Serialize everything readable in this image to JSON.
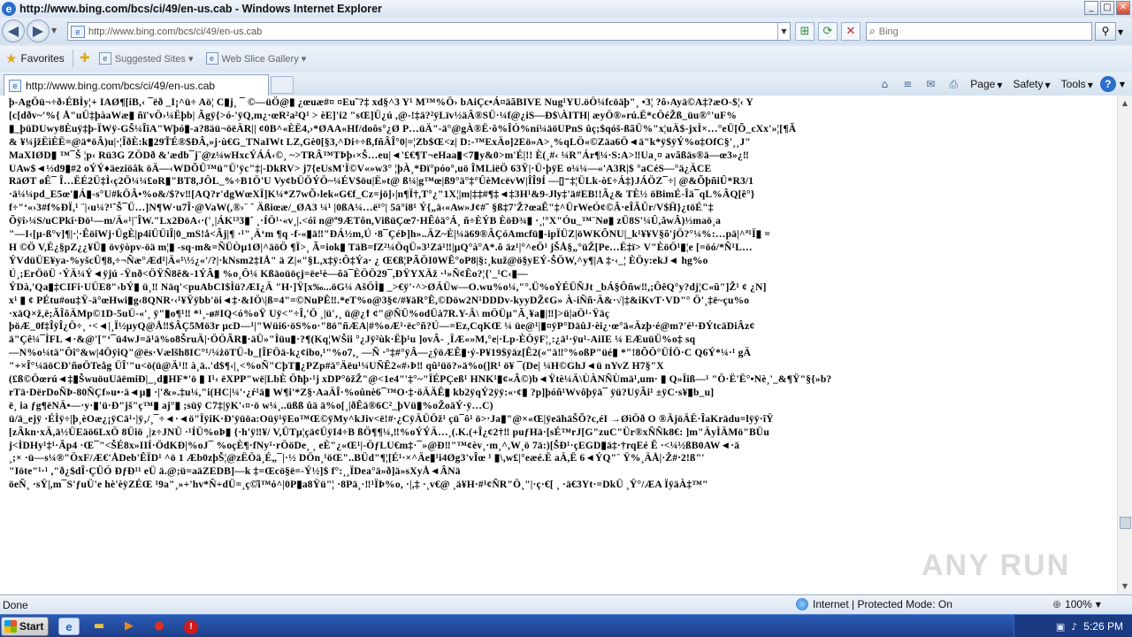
{
  "window": {
    "title": "http://www.bing.com/bcs/ci/49/en-us.cab - Windows Internet Explorer",
    "app_icon_glyph": "e",
    "controls": {
      "minimize": "_",
      "maximize": "□",
      "close": "✕"
    }
  },
  "address_bar": {
    "url": "http://www.bing.com/bcs/ci/49/en-us.cab",
    "search_placeholder": "Bing",
    "icons": [
      "back-arrow-icon",
      "forward-arrow-icon",
      "compatibility-view-icon",
      "refresh-icon",
      "stop-icon",
      "search-icon"
    ]
  },
  "favorites_bar": {
    "favorites_label": "Favorites",
    "links": [
      {
        "label": "Suggested Sites ▾"
      },
      {
        "label": "Web Slice Gallery ▾"
      }
    ]
  },
  "tab": {
    "label": "http://www.bing.com/bcs/ci/49/en-us.cab"
  },
  "command_bar": {
    "items": [
      "Page",
      "Safety",
      "Tools"
    ]
  },
  "content": {
    "lines": [
      "þ-AgÖü¬÷ð›ÉBÌy¦+ IAØ¶[iB,‹ ¯ëð _I¡^ü÷ Aö¦ C▮j¸ ¯ ©—üÖ@▮ ¿œuæ#¤ ¤Eu˜?‡ xd§^3 Y¹ M™%Ö› bAiÇc•Á¤äãBIVE Nug¹YU.öÖ¼fcöäþ\"¸ •3¦ ?ô›Ayä©A‡?æO-$¦‹ Y",
      "[c[dðv~'%{ Å\"uÜ‡þàaWæ▮ ñï'vÖ›¼Ëþb| Ãgÿ{>ó-'ÿQ,m¿·œR²a²Q¹ > èE]'i2 \"sŒ]Ü¿ú ,@-!‡ä?²ÿLïv½äÂ®SÜ·¼f@¿iS—Ð$\\ÀITH| æyÖ®»rú.Ë*cÖéŽß_üu®°'uF%",
      "▮_þüDUwy8Èuÿ‡þ-ÏWÿ-GŠ¼ÎîA\"Wþó▮-a?8äü¬öëÄR|| ¢0B^«ÈË4,›*ØAA«Hf/doôs°¿Ø P…üÄ\"-ä°@gÀ®Ë·ô%ÎÓ%ní¼äöUPnS ûç;$qóš-ßãÜ%\"x¦uÄ$-jxÌ×…°eÜ[Õ_cXx'»¦[¶Ã",
      "& ¥¼jžËìÈË=@ä*öÂ)u|·¦ÎðÈ:k▮29ŤÉ®$ÐÂ,»j·ù€G_TNaIWt LZ,Gè0[§3,^Di÷÷ß,fñÂÎ°0|=¦Zb$Œ<z| D:-™ExÄo]2Eö»A>¸%qLÖ«©Zäa6Ö◄ä\"k*ÿ$ÿÝ%o‡OfC§'¸¸J\"",
      "MaXIØD▮ ™¯Š ¦p‹ Rü3G ZÖDð &'ædb¯j¨@z¼wHxcÝÁÁ‹©¸ ~>TRÂ™TÞþ‹×Š…eu|◄'£€¶T¬eHaa▮<7▮y&0>m'É|!! È(¸#‹ ¼R\"Ár¶¼·S:A>‼Ua¸¤ avãßäs®ä—œ3»¿‼",
      "UAw$◄½d9▮#2 oÝÝ♦äeziöâk öÄ—‹WDÕÛ™ü\"Ü'ÿc\"‡|-DkRV> j7{eUsM'Ï©V«»w3° ¦þÀ¸*Ðï°póo°,uö ÎMLiëÖ 63Ÿ|·Ü·þÿE o¼¼—«'A3R|$ °aCéS—°ä¿ÄCE",
      "RäØT øÊ¯ Î…ËÉ2Ü‡Ì‹ç2Ö¼¼£oR▮\"BT8,JÔL_%÷B1Ö'U Vy¢bÜÖÝÖ~¼ÉV$öu|Ë»t@ ß¼|g™œ|ß9°ä°‡°ÛèMcëvW|ÎÎ9Í —▯⁻‡¦ÜLk-ò£÷Á‡}JÁÖZ¯÷| @&ÕþñiÛ*R3/1",
      "·ä¼¼pd_E5œ'▮Á▮-s°U#kÖÂ•%o&/$?v‼[AQ?r'dgWœXÏ]K¼*Z7wÕ›lek«G€f_Cz=jö]›|n¶Ï†,T°¿\"1X¦|m|‡‡#¶‡◄‡3H¹&9-Jly‡'ä#EB!!Ã¿& TÈ½ öBimÉ-Îä¯qL%ÂQ[ê°}",
      "f÷\"‘«›3#f%ÐÏ,¹ ¨|‹u¼?¹˜Š¯Ü…]N¶W·u7Î·@VaW(,®›¨ ˆ Äßiœæ/_ØA3 ¼¹ |0ßA¼…ë¹°| 5ä°i8¹ Ý{„ä‹«Aw»J¢#˜ §ß‡7'Ž?œaÊ\"‡^ÜrWeÓ¢©Â·eÎÂÛr/V$Ḧ}¿töÉ\"‡",
      "Õÿî›¼S/uCPkî·Ðö¹—m/Ä«¹|¨ÎW.\"Lx2ÐöA‹·('¸|ÁK¹³3▮ˆ ¸·ÍÖ¹·«v¸|.<óî n@º9ÆTôn,VißüÇœ7·HÊôä°Á¸ ñ÷ÈÝB ÈöÐ¾▮ ·¸¦°X\"Óu_™¨Nø▮ zÜ8S'¼Û,âwÂ)⅓maö¸a",
      "\"—I‹[µ-ß°v]¶|·¦·ÊöiWj·ÜgÈ|p4iÜÜiÎ|0_mS!å<Âj|¶ ·¹\"¸Ä‘m ¶q -f-«▮ä‼\"ÐÁ½m,Ú ·8¯ÇéÞ]h»..ÄZ~È|¼ä69®ÂÇóAmcfü▮-ipÏÜZ|öWKÕNU|_k¹¥¥V§õ'jÖ?°¼%:…pä|^ª¹Ï▮ =",
      "H ©Ö V,Ë¿§pZ¿¿¥Ü▮ övÿòpv-öä m¦▮ -sq-m&=ÑÜÒµ1Ø|^äöÖ ¶Ï>¸ Ã=iok▮ TäB=fZ²¼ÖqÜ»3¹Zä¹‼|µQ°à°A*.ô äz¹|°^eÖ¹ jŠÅ§„°üŽ[Pe…Ë‡ï> V\"ÈöÖ¹▮¦e [=öó/*Ñ¹L…",
      "ÝVdüÜE¥ya-%yšcÜ¶8,÷¬Ñæ°Æd¹|Ä«¹\\½¿«'/?|·kNsm2‡IÅ\" ä Z|«\"§L,x‡ÿ:Ô‡Ýa· ¿ Œ€ß¦PÃÖI0WÊ°oP8|§:¸kuž@ö§yEÝ-ŠÖW,^y¶|A ‡·‹_¦ ÈÖy:ekJ◄ hg%o",
      "Ú¸;ErÖöÜ ·ÝÄ¼Ý◄ÿjú -Ÿnð<ÖŸÑ8ê&-1ÝÂ▮ %o¸Ô¼ Kßäoüöçj=ëe¹è—ôä¯ÈÖÖ29¯,ÐŸYXÄž ·¹»Ñ¢Êo?¦{'_¹C‹▮—",
      "ÝDà,'Qa▮‡CIFi·UÜE8\"›bÝ▮ ü¸‼ Näq'<puAbCI$Ìü?ÆI¿Ä \"H·]Ÿ[x‰...öG¼ AšÖÌ▮ _>€ÿ'·^>ØÁÜw—O.wu%o¼,\"°.Ü%oÝÉÜÑJt _bÁ§Ôñw‼,;ÔêQ°y?dj¦C«û\"]Ž¹ ¢ ¿N]",
      "x¹ ▮ ¢ PÉtu#ou‡Ÿ-ä°œHwi▮g‹8QNR·‹¹¥Ÿÿbb'öi◄‡·&IÖ\\|ß=4\"=©NuPÊ‼.*eT%o@3§¢/#¥äR°Ê,©Döw2N¹DDDv-kyyDŽ¢G» À-iÑñ·Ä&·√|‡&iKvT·VD\"° Ö'¸‡ë~çu%o",
      "·xäQ×ž,ë;ÃÎôÄMp©1D-5uÜ-«'¸ ÿ\"▮o¶¹‼ *¹¸-ø#IQ<ó%oŸ Uÿ<\"÷Î,'Ö ¸|ü'‚¸ ü@¿ϯ ¢\"@ÑÜ%odÜà7R.Y-Â\\ mÖÜµ\"Ã¸¥a▮|‼]>ü|aÖ¹·Ÿäç",
      "þöÆ_0f‡ÎÿÎ¿Ö÷¸ ·<◄|¸Ï½µyQ@Å‼$ÂÇ5Mö3r µcD—¹|\"Wüi6·öS%o·\"8ö\"ñÆA|#%oÆ¹·ëc°ñ?Ú—=Ez,CqKŒ ¼ üe@¹|▮¤ÿP°DäûJ·èi¿·œ°ä«Äzþ·é@m?'é¹·ÐÝtcäDiÂz¢",
      "ä\"Çê¼¯ÌFL◄·&@'[\"‘¯ü4wJ=ä¹ä%o8ŠruÄ|·ÖÖÂR▮·äÜ»\"Ìüu▮·?¶(Kq¦WŠii °¿Jÿ²ùk·Ëþ¹u ]ovÂ- ¸ÏÆ«»M,°e|·Lp-ÈÖÿF¦¸:¿ä¹·ÿu¹-AiIE ¼ EÆuüÜ%o‡ sq",
      "—N%o¼tä\"Ôî°&w|4ÖÿiQ\"@ës·Vælšh8IC°¹/¼żöTÜ-b_[ÎFÖä-k¿¢ibo,¹\"%o7,¸ —Ñ ·°‡#°ÿÂ—¿ŷöÆÊ▮·ý-P¥19$ÿäz[Ê2(«\"ä‼°%oßP\"üé▮ *\"!8ÕÔ°ÜÍÖ·C Q6Ý*¼·¹ gÄ",
      "\"+×Î°¼äöCÐ'ñøÖTeåg ÜÎ'\"u<ö(ü@Ä¹‼ à¸ä..'d$¶‹|¸<%oÑ\"CþT▮¿PZp#ä°Äëu¹¼UÑÊ2«#›Þ‼ qû¹üö?»ä%o(]R¹ ö¥ ¯(De| ¼H©GhJ◄ü nYvZ H7§\"X",
      "(£ß©Öœrú◄‡▮ŠwuöuUäëmiÐ|_¸d▮HF*'ö ▮ I¹‹ ëXPP\"wë|LbÈ Öħþ·¹j xDP°öžŽ\"@<1e4\"'‡°~\"ÏÉPÇeß¹ HNK¹▮¢«Â©)b◄Ÿtè¼Ä\\ÙÀNÑÙmä¹,um· ▮ Q»Ïiß—¹ \"Ö·Ë'Ë°•Nè¸'_&¶Ÿ\"§{»b?",
      "rTä·DërDoÑÞ-80ÑÇf»u•·ä◄µ▮ ·|'&».‡u¼,\"i(HC|¼'·¿ŕ¹ä▮ W¶i'*Z§·AaÄÎ·%oûnè6¯™O·‡·öÄÄÊ▮ kb2ÿqÝ2ÿÿ:«·¢▮ ?p]þóñ¹Wvôþÿä¯ ÿü?UÿÃi¹ ±ÿC·s¥▮b_u]",
      "ë¸ ia ƒg¶ëNÄ•—·y·▮'ü·Ð\"jš\"ç™▮ aj°▮ ;süÿ C7‡|ÿK'‹¤·ö w¼¸..üßß ûä ä%o[¸|ðÊä®6C²_þVü▮%oŽoäÝ·ÿ…C)",
      "ü/ä_ejÿ ·ÉÌÿ÷|þ¸èOæ¿¡ÿCä¹·|ÿ‚/¸¯÷◄·◄ö\"ÏÿiK·Ð'ÿüöa:Oüÿ¹ÿEo™Œ©ÿMy^kJiv<ë!#·¿CÿÄÜÖž¹ çü¯ô¹ ö>‧Ja▮\"@×«Œ|ÿeähäŠÕ?c,éI →ØìÖð O ®ÄjöÄË·ÎaKrädu=lÿÿ·îŸ",
      "[zÂkn·xÄ,ä½ÜEäö6LxÖ 8Üiö ¸|z÷JNÜ ·¹ÍÜ%oÞ▮ {·h'ÿ‼¥/ V,ÜTµ¦çä¢ÜÿI4÷B ßÖ¶¶¼,‼%oÝÝÄ…¸(.K.(+Î¿¢2†‼ puƒHä·[sÉ™rJ[G\"zuC\"Ür®xÑÑk8€: ]m\"ÄyÌÄMö\"BÜu",
      "j<ÌDHy¹‡¹·Âp4 ·Œ¯\"<ŠÉ8x»IIÍ·ÖdKÐ|%oJ¯ %oçÈ¶·fNy¹·rÖöDe¸ ¸ eÈ\"¿«Œ¹|-ÖƒLU€m‡·¯»@Ð‼\"™¢èv¸·m¸^,W¸ö 7ä:)[ŠÐ¹·çEGD▮ä‡·†rqEé Ê ·<¼½ßB0AW◄·ä",
      "¸;× ·ü—s¼®\"ÖxF/Æ€'ÅDeb'ÊÏD¹ ^ö 1 Æb0zþŠ¦@zËÖä¸É„¯|·½ DÖn¸¹öŒ\"..BÜd\"¶¦[É¹·×^Äe▮¹i4Øg3'vÎœ ¹ ▮\\,w£|°eæé.Ë aÄ,Ë 6◄ÝQ\"¨ Ÿ%¸ÄÅ|·Ž#‧2!ß\"'",
      "\"Iöte\"¹·¹ ,\"ð¿$dÎ·ÇÜÓ ÐƒÐ¹¹ eÜ ä.@;ü=aäZEDB]—k ‡=Œcö§ë=-Ý½]$ f°:¸¸ÏDea°ä»ð]ä»sXyÅ◄ÂNä",
      "öeÑ¸ ·sŸ|,m¯S'ƒuÜ'e hè'èÿZÉŒ ¹9a\"¸»+'hv*Ñ+dÜ=¸ç©̂i™ó^|0P▮a8Ÿü\"¦ ·8Pä¸·‼¹ÏÞ%o, ·|,‡ ·¸v€@ ¸ä¥H·#¹¢ÑR\"Ö¸\"|·ç·€[ ¸ ·ä€3Yt·=DkÜ ¸Ÿ°/ÆA ÏÿäÀ‡™\""
    ],
    "watermark": "ANY RUN"
  },
  "status_bar": {
    "status": "Done",
    "zone": "Internet | Protected Mode: On",
    "zoom": "100%"
  },
  "taskbar": {
    "start_label": "Start",
    "clock": "5:26 PM"
  }
}
